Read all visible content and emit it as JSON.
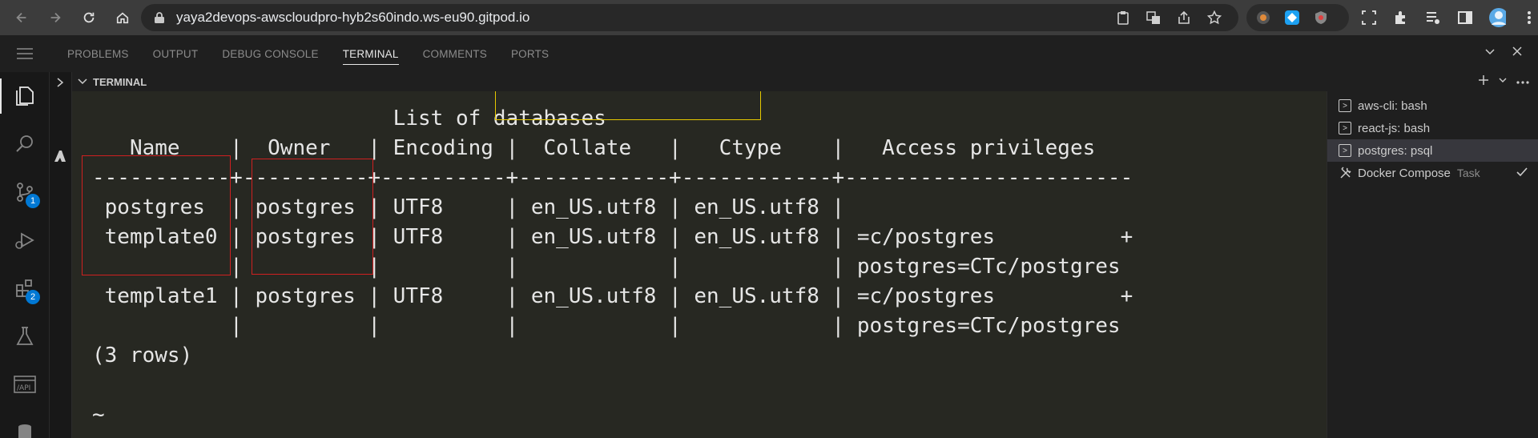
{
  "browser": {
    "url": "yaya2devops-awscloudpro-hyb2s60indo.ws-eu90.gitpod.io"
  },
  "panel": {
    "tabs": [
      {
        "label": "PROBLEMS"
      },
      {
        "label": "OUTPUT"
      },
      {
        "label": "DEBUG CONSOLE"
      },
      {
        "label": "TERMINAL"
      },
      {
        "label": "COMMENTS"
      },
      {
        "label": "PORTS"
      }
    ],
    "active_tab": "TERMINAL"
  },
  "activity_bar": {
    "source_control_badge": "1",
    "extensions_badge": "2"
  },
  "terminal_header": {
    "title": "TERMINAL"
  },
  "terminal": {
    "lines": [
      "                        List of databases",
      "   Name    |  Owner   | Encoding |  Collate   |   Ctype    |   Access privileges",
      "-----------+----------+----------+------------+------------+-----------------------",
      " postgres  | postgres | UTF8     | en_US.utf8 | en_US.utf8 |",
      " template0 | postgres | UTF8     | en_US.utf8 | en_US.utf8 | =c/postgres          +",
      "           |          |          |            |            | postgres=CTc/postgres",
      " template1 | postgres | UTF8     | en_US.utf8 | en_US.utf8 | =c/postgres          +",
      "           |          |          |            |            | postgres=CTc/postgres",
      "(3 rows)",
      "",
      "~"
    ]
  },
  "terminal_list": {
    "items": [
      {
        "label": "aws-cli: bash",
        "task": ""
      },
      {
        "label": "react-js: bash",
        "task": ""
      },
      {
        "label": "postgres: psql",
        "task": ""
      },
      {
        "label": "Docker Compose",
        "task": "Task"
      }
    ]
  },
  "colors": {
    "accent_blue": "#0078d4",
    "highlight_yellow": "#e6c800",
    "highlight_red": "#d02020"
  }
}
